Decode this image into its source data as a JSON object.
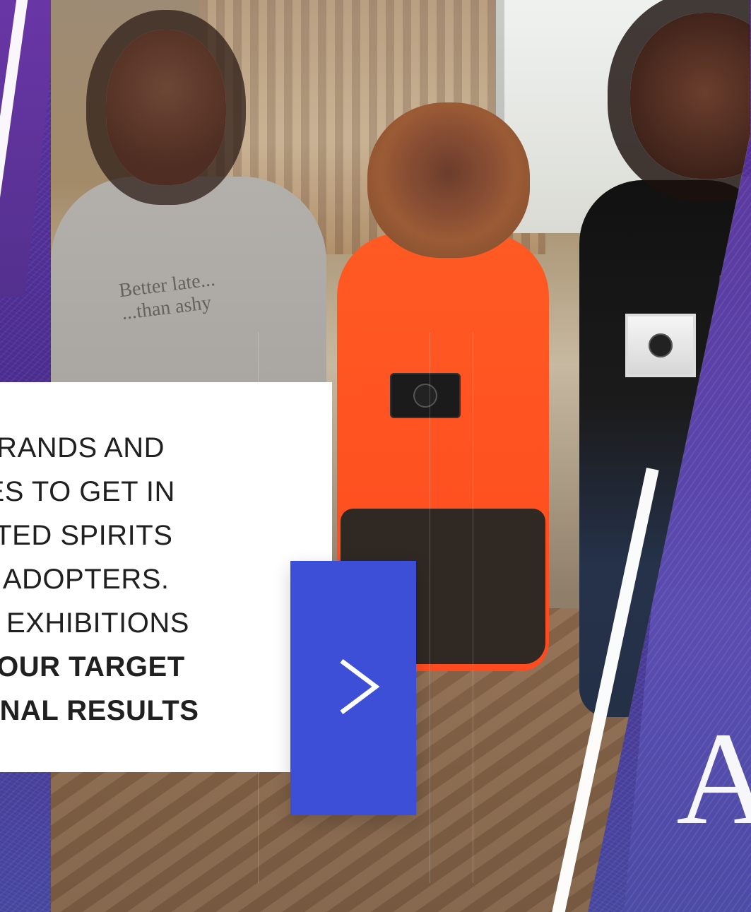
{
  "hero": {
    "left_text_lines": [
      "BRANDS AND",
      "IES TO GET IN",
      "ATED SPIRITS",
      "Y ADOPTERS.",
      "D EXHIBITIONS",
      "YOUR TARGET",
      "ONAL RESULTS"
    ],
    "shirt_text_line_1": "Better late...",
    "shirt_text_line_2": "...than ashy",
    "right_partial_letter": "A",
    "next_icon": "chevron-right-icon"
  },
  "colors": {
    "accent_blue": "#3c4fd6",
    "purple": "#5b3aa1",
    "white": "#ffffff",
    "text": "#202020"
  }
}
